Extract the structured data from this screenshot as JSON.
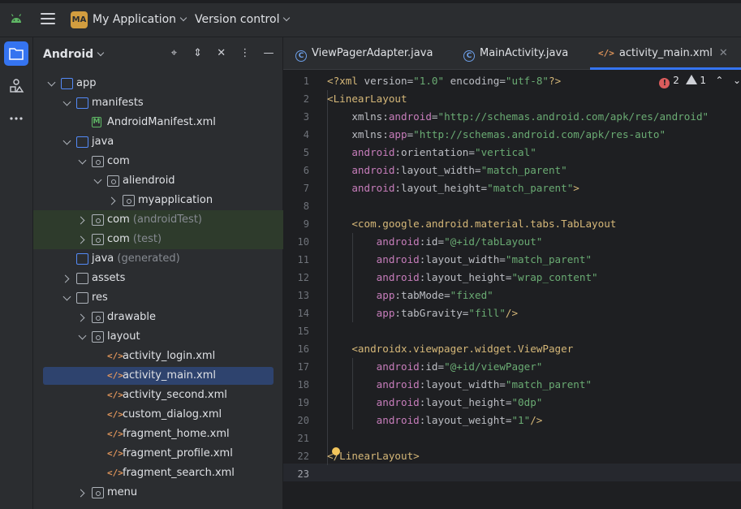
{
  "titlebar": {
    "project_badge": "MA",
    "project_name": "My Application",
    "vcs_label": "Version control"
  },
  "colors": {
    "accent": "#3574f0",
    "badge": "#d29d3f",
    "test_bg": "#2e3b2c",
    "selection": "#2e436e"
  },
  "project_panel": {
    "title": "Android",
    "tools": [
      "target-icon",
      "expand-icon",
      "collapse-icon",
      "more-icon",
      "minimize-icon"
    ],
    "tree": [
      {
        "label": "app",
        "suffix": "",
        "indent": 0,
        "arrow": "down",
        "icon": "folder"
      },
      {
        "label": "manifests",
        "suffix": "",
        "indent": 1,
        "arrow": "down",
        "icon": "folder"
      },
      {
        "label": "AndroidManifest.xml",
        "suffix": "",
        "indent": 2,
        "arrow": "",
        "icon": "manifest"
      },
      {
        "label": "java",
        "suffix": "",
        "indent": 1,
        "arrow": "down",
        "icon": "folder"
      },
      {
        "label": "com",
        "suffix": "",
        "indent": 2,
        "arrow": "down",
        "icon": "package"
      },
      {
        "label": "aliendroid",
        "suffix": "",
        "indent": 3,
        "arrow": "down",
        "icon": "package"
      },
      {
        "label": "myapplication",
        "suffix": "",
        "indent": 4,
        "arrow": "right",
        "icon": "package"
      },
      {
        "label": "com",
        "suffix": "(androidTest)",
        "indent": 2,
        "arrow": "right",
        "icon": "package",
        "test": true
      },
      {
        "label": "com",
        "suffix": "(test)",
        "indent": 2,
        "arrow": "right",
        "icon": "package",
        "test": true
      },
      {
        "label": "java",
        "suffix": "(generated)",
        "indent": 1,
        "arrow": "",
        "icon": "folder"
      },
      {
        "label": "assets",
        "suffix": "",
        "indent": 1,
        "arrow": "right",
        "icon": "folder-gray"
      },
      {
        "label": "res",
        "suffix": "",
        "indent": 1,
        "arrow": "down",
        "icon": "folder-gray"
      },
      {
        "label": "drawable",
        "suffix": "",
        "indent": 2,
        "arrow": "right",
        "icon": "package"
      },
      {
        "label": "layout",
        "suffix": "",
        "indent": 2,
        "arrow": "down",
        "icon": "package"
      },
      {
        "label": "activity_login.xml",
        "suffix": "",
        "indent": 3,
        "arrow": "",
        "icon": "xml"
      },
      {
        "label": "activity_main.xml",
        "suffix": "",
        "indent": 3,
        "arrow": "",
        "icon": "xml",
        "selected": true
      },
      {
        "label": "activity_second.xml",
        "suffix": "",
        "indent": 3,
        "arrow": "",
        "icon": "xml"
      },
      {
        "label": "custom_dialog.xml",
        "suffix": "",
        "indent": 3,
        "arrow": "",
        "icon": "xml"
      },
      {
        "label": "fragment_home.xml",
        "suffix": "",
        "indent": 3,
        "arrow": "",
        "icon": "xml"
      },
      {
        "label": "fragment_profile.xml",
        "suffix": "",
        "indent": 3,
        "arrow": "",
        "icon": "xml"
      },
      {
        "label": "fragment_search.xml",
        "suffix": "",
        "indent": 3,
        "arrow": "",
        "icon": "xml"
      },
      {
        "label": "menu",
        "suffix": "",
        "indent": 2,
        "arrow": "right",
        "icon": "package"
      }
    ]
  },
  "tabs": [
    {
      "label": "ViewPagerAdapter.java",
      "type": "java",
      "active": false
    },
    {
      "label": "MainActivity.java",
      "type": "java",
      "active": false
    },
    {
      "label": "activity_main.xml",
      "type": "xml",
      "active": true
    }
  ],
  "editor": {
    "errors": "2",
    "warnings": "1",
    "current_line": 23,
    "lines": [
      [
        [
          "pi",
          "<?xml "
        ],
        [
          "attr",
          "version="
        ],
        [
          "val",
          "\"1.0\""
        ],
        [
          "attr",
          " encoding="
        ],
        [
          "val",
          "\"utf-8\""
        ],
        [
          "pi",
          "?>"
        ]
      ],
      [
        [
          "tag",
          "<LinearLayout"
        ]
      ],
      [
        [
          "plain",
          "    xmlns:"
        ],
        [
          "ns",
          "android"
        ],
        [
          "plain",
          "="
        ],
        [
          "val",
          "\"http://schemas.android.com/apk/res/android\""
        ]
      ],
      [
        [
          "plain",
          "    xmlns:"
        ],
        [
          "ns",
          "app"
        ],
        [
          "plain",
          "="
        ],
        [
          "val",
          "\"http://schemas.android.com/apk/res-auto\""
        ]
      ],
      [
        [
          "ns",
          "    android"
        ],
        [
          "plain",
          ":orientation="
        ],
        [
          "val",
          "\"vertical\""
        ]
      ],
      [
        [
          "ns",
          "    android"
        ],
        [
          "plain",
          ":layout_width="
        ],
        [
          "val",
          "\"match_parent\""
        ]
      ],
      [
        [
          "ns",
          "    android"
        ],
        [
          "plain",
          ":layout_height="
        ],
        [
          "val",
          "\"match_parent\""
        ],
        [
          "tag",
          ">"
        ]
      ],
      [
        [
          "plain",
          ""
        ]
      ],
      [
        [
          "tag",
          "    <com.google.android.material.tabs.TabLayout"
        ]
      ],
      [
        [
          "ns",
          "        android"
        ],
        [
          "plain",
          ":id="
        ],
        [
          "val",
          "\"@+id/tabLayout\""
        ]
      ],
      [
        [
          "ns",
          "        android"
        ],
        [
          "plain",
          ":layout_width="
        ],
        [
          "val",
          "\"match_parent\""
        ]
      ],
      [
        [
          "ns",
          "        android"
        ],
        [
          "plain",
          ":layout_height="
        ],
        [
          "val",
          "\"wrap_content\""
        ]
      ],
      [
        [
          "ns",
          "        app"
        ],
        [
          "plain",
          ":tabMode="
        ],
        [
          "val",
          "\"fixed\""
        ]
      ],
      [
        [
          "ns",
          "        app"
        ],
        [
          "plain",
          ":tabGravity="
        ],
        [
          "val",
          "\"fill\""
        ],
        [
          "tag",
          "/>"
        ]
      ],
      [
        [
          "plain",
          ""
        ]
      ],
      [
        [
          "tag",
          "    <androidx.viewpager.widget.ViewPager"
        ]
      ],
      [
        [
          "ns",
          "        android"
        ],
        [
          "plain",
          ":id="
        ],
        [
          "val",
          "\"@+id/viewPager\""
        ]
      ],
      [
        [
          "ns",
          "        android"
        ],
        [
          "plain",
          ":layout_width="
        ],
        [
          "val",
          "\"match_parent\""
        ]
      ],
      [
        [
          "ns",
          "        android"
        ],
        [
          "plain",
          ":layout_height="
        ],
        [
          "val",
          "\"0dp\""
        ]
      ],
      [
        [
          "ns",
          "        android"
        ],
        [
          "plain",
          ":layout_weight="
        ],
        [
          "val",
          "\"1\""
        ],
        [
          "tag",
          "/>"
        ]
      ],
      [
        [
          "plain",
          ""
        ]
      ],
      [
        [
          "tag",
          "</LinearLayout>"
        ]
      ],
      [
        [
          "plain",
          ""
        ]
      ]
    ]
  }
}
